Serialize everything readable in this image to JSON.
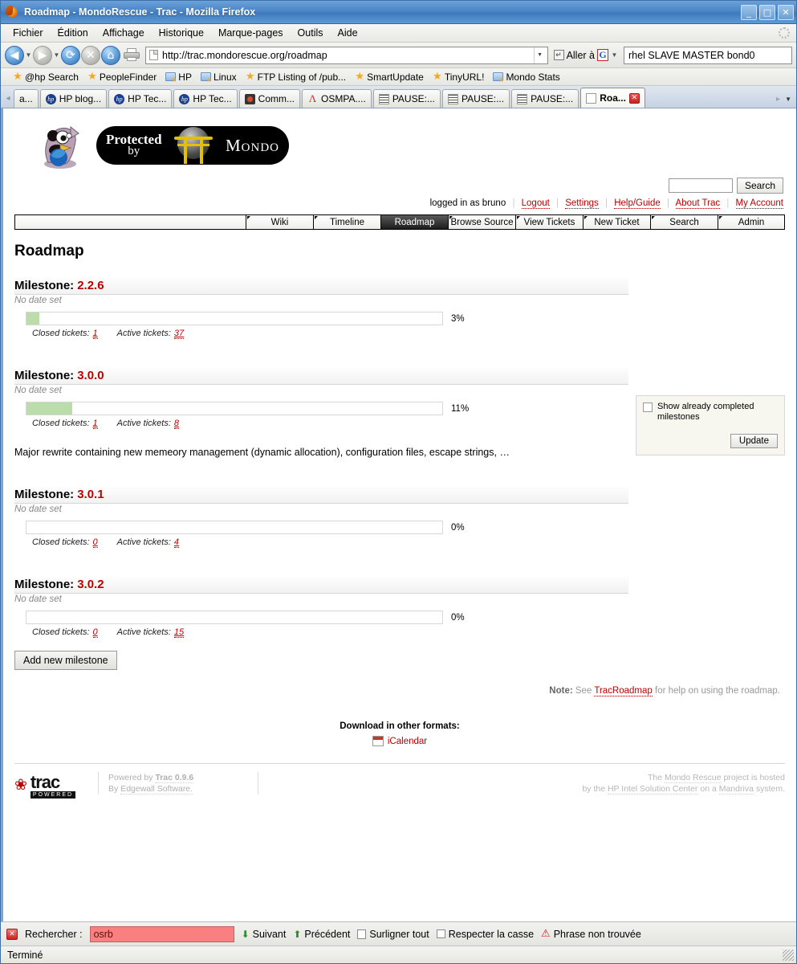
{
  "window": {
    "title": "Roadmap - MondoRescue - Trac - Mozilla Firefox",
    "minimize": "_",
    "maximize": "□",
    "close": "✕"
  },
  "menubar": {
    "items": [
      "Fichier",
      "Édition",
      "Affichage",
      "Historique",
      "Marque-pages",
      "Outils",
      "Aide"
    ]
  },
  "toolbar": {
    "url": "http://trac.mondorescue.org/roadmap",
    "goto_label": "Aller à",
    "search_value": "rhel SLAVE MASTER bond0",
    "back_icon": "back-arrow",
    "forward_icon": "forward-arrow",
    "reload_icon": "reload-arrow",
    "stop_icon": "stop-x",
    "home_icon": "home",
    "print_icon": "printer"
  },
  "bookmarks": [
    {
      "label": "@hp Search",
      "icon": "star-icon"
    },
    {
      "label": "PeopleFinder",
      "icon": "star-icon"
    },
    {
      "label": "HP",
      "icon": "folder-icon"
    },
    {
      "label": "Linux",
      "icon": "folder-icon"
    },
    {
      "label": "FTP Listing of /pub...",
      "icon": "star-icon"
    },
    {
      "label": "SmartUpdate",
      "icon": "star-icon"
    },
    {
      "label": "TinyURL!",
      "icon": "star-icon"
    },
    {
      "label": "Mondo Stats",
      "icon": "folder-icon"
    }
  ],
  "tabs": [
    {
      "label": "a...",
      "icon": "none",
      "active": false
    },
    {
      "label": "HP blog...",
      "icon": "hp",
      "active": false
    },
    {
      "label": "HP Tec...",
      "icon": "hp",
      "active": false
    },
    {
      "label": "HP Tec...",
      "icon": "hp",
      "active": false
    },
    {
      "label": "Comm...",
      "icon": "comm",
      "active": false
    },
    {
      "label": "OSMPA....",
      "icon": "osmpa",
      "active": false
    },
    {
      "label": "PAUSE:...",
      "icon": "pause",
      "active": false
    },
    {
      "label": "PAUSE:...",
      "icon": "pause",
      "active": false
    },
    {
      "label": "PAUSE:...",
      "icon": "pause",
      "active": false
    },
    {
      "label": "Roa...",
      "icon": "doc",
      "active": true
    }
  ],
  "site": {
    "logo_protected": "Protected",
    "logo_by": "by",
    "logo_name": "Mondo",
    "search_placeholder": "",
    "search_button": "Search"
  },
  "metanav": {
    "logged_in": "logged in as bruno",
    "links": [
      "Logout",
      "Settings",
      "Help/Guide",
      "About Trac",
      "My Account"
    ]
  },
  "mainnav": [
    {
      "label": "Wiki",
      "active": false
    },
    {
      "label": "Timeline",
      "active": false
    },
    {
      "label": "Roadmap",
      "active": true
    },
    {
      "label": "Browse Source",
      "active": false
    },
    {
      "label": "View Tickets",
      "active": false
    },
    {
      "label": "New Ticket",
      "active": false
    },
    {
      "label": "Search",
      "active": false
    },
    {
      "label": "Admin",
      "active": false
    }
  ],
  "page": {
    "title": "Roadmap",
    "add_milestone_button": "Add new milestone",
    "note_prefix": "Note:",
    "note_see": "See",
    "note_link": "TracRoadmap",
    "note_suffix": "for help on using the roadmap.",
    "download_header": "Download in other formats:",
    "download_link": "iCalendar"
  },
  "prefs": {
    "checkbox_label": "Show already completed milestones",
    "checkbox_checked": false,
    "update_button": "Update"
  },
  "labels": {
    "milestone_prefix": "Milestone:",
    "no_date": "No date set",
    "closed_tickets": "Closed tickets:",
    "active_tickets": "Active tickets:"
  },
  "milestones": [
    {
      "version": "2.2.6",
      "date": "No date set",
      "percent": "3%",
      "percent_value": 3,
      "closed": "1",
      "active": "37",
      "description": ""
    },
    {
      "version": "3.0.0",
      "date": "No date set",
      "percent": "11%",
      "percent_value": 11,
      "closed": "1",
      "active": "8",
      "description": "Major rewrite containing new memeory management (dynamic allocation), configuration files, escape strings, …"
    },
    {
      "version": "3.0.1",
      "date": "No date set",
      "percent": "0%",
      "percent_value": 0,
      "closed": "0",
      "active": "4",
      "description": ""
    },
    {
      "version": "3.0.2",
      "date": "No date set",
      "percent": "0%",
      "percent_value": 0,
      "closed": "0",
      "active": "15",
      "description": ""
    }
  ],
  "footer": {
    "powered_by": "Powered by",
    "trac_version": "Trac 0.9.6",
    "by": "By",
    "edgewall": "Edgewall Software.",
    "host_line1_pre": "The",
    "host_line1_link": "Mondo Rescue",
    "host_line1_post": "project is hosted",
    "host_line2_pre": "by the",
    "host_line2_link1": "HP Intel Solution Center",
    "host_line2_mid": "on a",
    "host_line2_link2": "Mandriva",
    "host_line2_post": "system.",
    "trac_word": "trac",
    "trac_powered": "POWERED"
  },
  "findbar": {
    "label": "Rechercher :",
    "value": "osrb",
    "next": "Suivant",
    "previous": "Précédent",
    "highlight_all": "Surligner tout",
    "match_case": "Respecter la casse",
    "not_found": "Phrase non trouvée",
    "close_icon": "close-icon"
  },
  "statusbar": {
    "text": "Terminé"
  },
  "colors": {
    "accent_red": "#bb0000",
    "progress_fill": "#bbddaa",
    "titlebar_blue": "#4a85c6",
    "find_error_bg": "#f98080"
  }
}
